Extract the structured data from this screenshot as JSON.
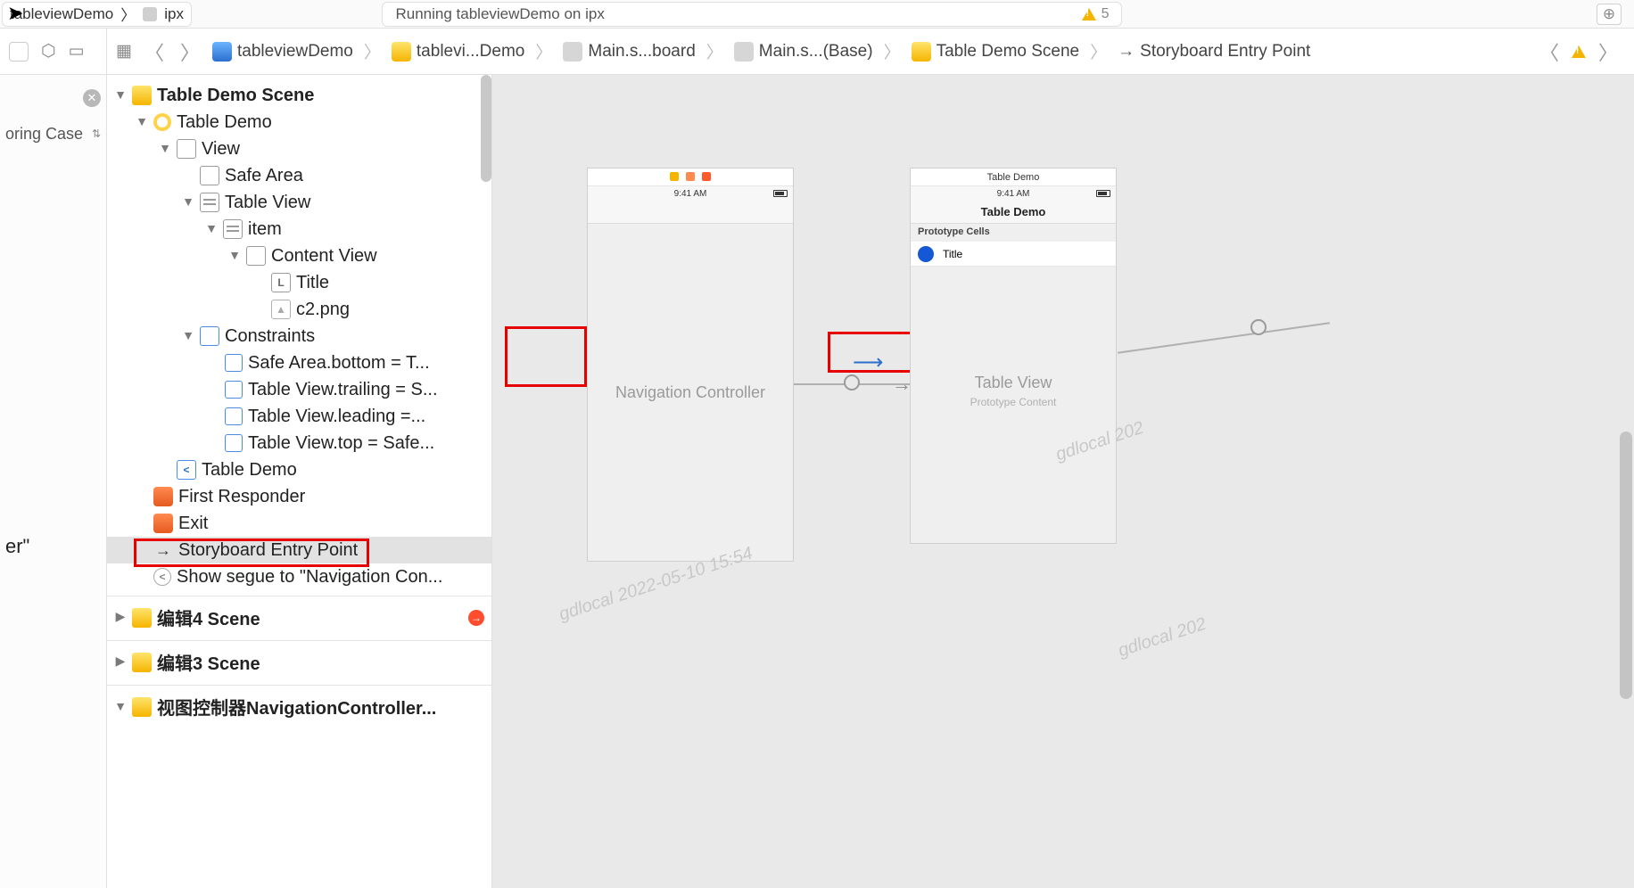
{
  "titlebar": {
    "scheme": "tableviewDemo",
    "device": "ipx",
    "status": "Running tableviewDemo on ipx",
    "warning_count": "5"
  },
  "leftcol": {
    "option": "oring Case",
    "stub": "er\""
  },
  "jumpbar": {
    "items": [
      {
        "label": "tableviewDemo",
        "icon": "blue"
      },
      {
        "label": "tablevi...Demo",
        "icon": "yel"
      },
      {
        "label": "Main.s...board",
        "icon": "gray"
      },
      {
        "label": "Main.s...(Base)",
        "icon": "gray"
      },
      {
        "label": "Table Demo Scene",
        "icon": "yel"
      },
      {
        "label": "Storyboard Entry Point",
        "icon": "arrow"
      }
    ]
  },
  "outline": {
    "scene1": "Table Demo Scene",
    "vc": "Table Demo",
    "view": "View",
    "safe": "Safe Area",
    "tableview": "Table View",
    "item": "item",
    "content": "Content View",
    "title": "Title",
    "img": "c2.png",
    "constraints": "Constraints",
    "c1": "Safe Area.bottom = T...",
    "c2": "Table View.trailing = S...",
    "c3": "Table View.leading =...",
    "c4": "Table View.top = Safe...",
    "navitem": "Table Demo",
    "first": "First Responder",
    "exit": "Exit",
    "entry": "Storyboard Entry Point",
    "segue": "Show segue to \"Navigation Con...",
    "scene2": "编辑4 Scene",
    "scene3": "编辑3 Scene",
    "scene4": "视图控制器NavigationController..."
  },
  "canvas": {
    "nav_label": "Navigation Controller",
    "time": "9:41 AM",
    "td_title": "Table Demo",
    "proto_head": "Prototype Cells",
    "proto_title": "Title",
    "tv_label": "Table View",
    "tv_sub": "Prototype Content",
    "watermark": "gdlocal 2022-05-10 15:54",
    "watermark2": "gdlocal 202"
  }
}
